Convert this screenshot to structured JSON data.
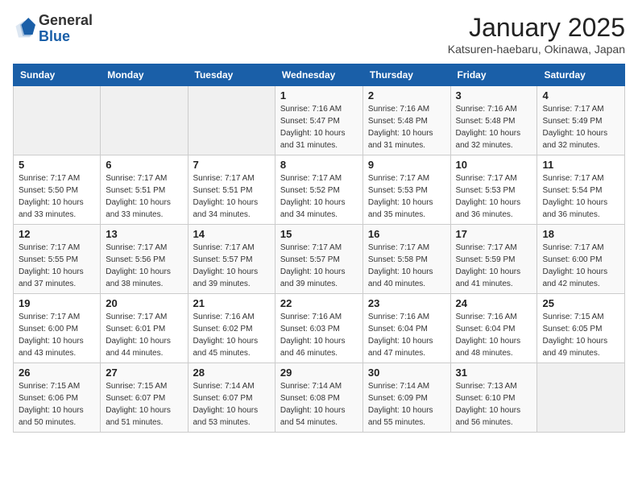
{
  "header": {
    "logo": {
      "general": "General",
      "blue": "Blue"
    },
    "title": "January 2025",
    "subtitle": "Katsuren-haebaru, Okinawa, Japan"
  },
  "weekdays": [
    "Sunday",
    "Monday",
    "Tuesday",
    "Wednesday",
    "Thursday",
    "Friday",
    "Saturday"
  ],
  "weeks": [
    [
      {
        "day": "",
        "sunrise": "",
        "sunset": "",
        "daylight": ""
      },
      {
        "day": "",
        "sunrise": "",
        "sunset": "",
        "daylight": ""
      },
      {
        "day": "",
        "sunrise": "",
        "sunset": "",
        "daylight": ""
      },
      {
        "day": "1",
        "sunrise": "Sunrise: 7:16 AM",
        "sunset": "Sunset: 5:47 PM",
        "daylight": "Daylight: 10 hours and 31 minutes."
      },
      {
        "day": "2",
        "sunrise": "Sunrise: 7:16 AM",
        "sunset": "Sunset: 5:48 PM",
        "daylight": "Daylight: 10 hours and 31 minutes."
      },
      {
        "day": "3",
        "sunrise": "Sunrise: 7:16 AM",
        "sunset": "Sunset: 5:48 PM",
        "daylight": "Daylight: 10 hours and 32 minutes."
      },
      {
        "day": "4",
        "sunrise": "Sunrise: 7:17 AM",
        "sunset": "Sunset: 5:49 PM",
        "daylight": "Daylight: 10 hours and 32 minutes."
      }
    ],
    [
      {
        "day": "5",
        "sunrise": "Sunrise: 7:17 AM",
        "sunset": "Sunset: 5:50 PM",
        "daylight": "Daylight: 10 hours and 33 minutes."
      },
      {
        "day": "6",
        "sunrise": "Sunrise: 7:17 AM",
        "sunset": "Sunset: 5:51 PM",
        "daylight": "Daylight: 10 hours and 33 minutes."
      },
      {
        "day": "7",
        "sunrise": "Sunrise: 7:17 AM",
        "sunset": "Sunset: 5:51 PM",
        "daylight": "Daylight: 10 hours and 34 minutes."
      },
      {
        "day": "8",
        "sunrise": "Sunrise: 7:17 AM",
        "sunset": "Sunset: 5:52 PM",
        "daylight": "Daylight: 10 hours and 34 minutes."
      },
      {
        "day": "9",
        "sunrise": "Sunrise: 7:17 AM",
        "sunset": "Sunset: 5:53 PM",
        "daylight": "Daylight: 10 hours and 35 minutes."
      },
      {
        "day": "10",
        "sunrise": "Sunrise: 7:17 AM",
        "sunset": "Sunset: 5:53 PM",
        "daylight": "Daylight: 10 hours and 36 minutes."
      },
      {
        "day": "11",
        "sunrise": "Sunrise: 7:17 AM",
        "sunset": "Sunset: 5:54 PM",
        "daylight": "Daylight: 10 hours and 36 minutes."
      }
    ],
    [
      {
        "day": "12",
        "sunrise": "Sunrise: 7:17 AM",
        "sunset": "Sunset: 5:55 PM",
        "daylight": "Daylight: 10 hours and 37 minutes."
      },
      {
        "day": "13",
        "sunrise": "Sunrise: 7:17 AM",
        "sunset": "Sunset: 5:56 PM",
        "daylight": "Daylight: 10 hours and 38 minutes."
      },
      {
        "day": "14",
        "sunrise": "Sunrise: 7:17 AM",
        "sunset": "Sunset: 5:57 PM",
        "daylight": "Daylight: 10 hours and 39 minutes."
      },
      {
        "day": "15",
        "sunrise": "Sunrise: 7:17 AM",
        "sunset": "Sunset: 5:57 PM",
        "daylight": "Daylight: 10 hours and 39 minutes."
      },
      {
        "day": "16",
        "sunrise": "Sunrise: 7:17 AM",
        "sunset": "Sunset: 5:58 PM",
        "daylight": "Daylight: 10 hours and 40 minutes."
      },
      {
        "day": "17",
        "sunrise": "Sunrise: 7:17 AM",
        "sunset": "Sunset: 5:59 PM",
        "daylight": "Daylight: 10 hours and 41 minutes."
      },
      {
        "day": "18",
        "sunrise": "Sunrise: 7:17 AM",
        "sunset": "Sunset: 6:00 PM",
        "daylight": "Daylight: 10 hours and 42 minutes."
      }
    ],
    [
      {
        "day": "19",
        "sunrise": "Sunrise: 7:17 AM",
        "sunset": "Sunset: 6:00 PM",
        "daylight": "Daylight: 10 hours and 43 minutes."
      },
      {
        "day": "20",
        "sunrise": "Sunrise: 7:17 AM",
        "sunset": "Sunset: 6:01 PM",
        "daylight": "Daylight: 10 hours and 44 minutes."
      },
      {
        "day": "21",
        "sunrise": "Sunrise: 7:16 AM",
        "sunset": "Sunset: 6:02 PM",
        "daylight": "Daylight: 10 hours and 45 minutes."
      },
      {
        "day": "22",
        "sunrise": "Sunrise: 7:16 AM",
        "sunset": "Sunset: 6:03 PM",
        "daylight": "Daylight: 10 hours and 46 minutes."
      },
      {
        "day": "23",
        "sunrise": "Sunrise: 7:16 AM",
        "sunset": "Sunset: 6:04 PM",
        "daylight": "Daylight: 10 hours and 47 minutes."
      },
      {
        "day": "24",
        "sunrise": "Sunrise: 7:16 AM",
        "sunset": "Sunset: 6:04 PM",
        "daylight": "Daylight: 10 hours and 48 minutes."
      },
      {
        "day": "25",
        "sunrise": "Sunrise: 7:15 AM",
        "sunset": "Sunset: 6:05 PM",
        "daylight": "Daylight: 10 hours and 49 minutes."
      }
    ],
    [
      {
        "day": "26",
        "sunrise": "Sunrise: 7:15 AM",
        "sunset": "Sunset: 6:06 PM",
        "daylight": "Daylight: 10 hours and 50 minutes."
      },
      {
        "day": "27",
        "sunrise": "Sunrise: 7:15 AM",
        "sunset": "Sunset: 6:07 PM",
        "daylight": "Daylight: 10 hours and 51 minutes."
      },
      {
        "day": "28",
        "sunrise": "Sunrise: 7:14 AM",
        "sunset": "Sunset: 6:07 PM",
        "daylight": "Daylight: 10 hours and 53 minutes."
      },
      {
        "day": "29",
        "sunrise": "Sunrise: 7:14 AM",
        "sunset": "Sunset: 6:08 PM",
        "daylight": "Daylight: 10 hours and 54 minutes."
      },
      {
        "day": "30",
        "sunrise": "Sunrise: 7:14 AM",
        "sunset": "Sunset: 6:09 PM",
        "daylight": "Daylight: 10 hours and 55 minutes."
      },
      {
        "day": "31",
        "sunrise": "Sunrise: 7:13 AM",
        "sunset": "Sunset: 6:10 PM",
        "daylight": "Daylight: 10 hours and 56 minutes."
      },
      {
        "day": "",
        "sunrise": "",
        "sunset": "",
        "daylight": ""
      }
    ]
  ]
}
